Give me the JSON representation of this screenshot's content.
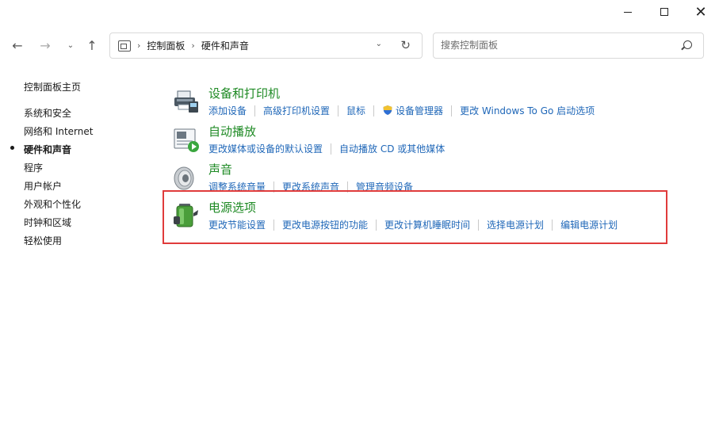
{
  "window": {
    "min_glyph": "",
    "close_glyph": "✕"
  },
  "nav": {
    "back": "←",
    "forward": "→",
    "recent": "⌄",
    "up": "↑"
  },
  "address": {
    "crumbs": [
      "控制面板",
      "硬件和声音"
    ],
    "separator": "›",
    "dropdown": "⌄",
    "refresh": "↻"
  },
  "search": {
    "placeholder": "搜索控制面板",
    "value": ""
  },
  "sidebar": {
    "items": [
      {
        "label": "控制面板主页"
      },
      {
        "label": "系统和安全"
      },
      {
        "label": "网络和 Internet"
      },
      {
        "label": "硬件和声音",
        "current": true
      },
      {
        "label": "程序"
      },
      {
        "label": "用户帐户"
      },
      {
        "label": "外观和个性化"
      },
      {
        "label": "时钟和区域"
      },
      {
        "label": "轻松使用"
      }
    ]
  },
  "categories": [
    {
      "title": "设备和打印机",
      "icon": "printer-icon",
      "links": [
        "添加设备",
        "高级打印机设置",
        "鼠标",
        "设备管理器",
        "更改 Windows To Go 启动选项"
      ]
    },
    {
      "title": "自动播放",
      "icon": "autoplay-icon",
      "links": [
        "更改媒体或设备的默认设置",
        "自动播放 CD 或其他媒体"
      ]
    },
    {
      "title": "声音",
      "icon": "speaker-icon",
      "links": [
        "调整系统音量",
        "更改系统声音",
        "管理音频设备"
      ]
    },
    {
      "title": "电源选项",
      "icon": "battery-icon",
      "links": [
        "更改节能设置",
        "更改电源按钮的功能",
        "更改计算机睡眠时间",
        "选择电源计划",
        "编辑电源计划"
      ]
    }
  ],
  "colors": {
    "category_title": "#1e8a24",
    "link": "#1f67b8",
    "highlight": "#e03b3b"
  }
}
